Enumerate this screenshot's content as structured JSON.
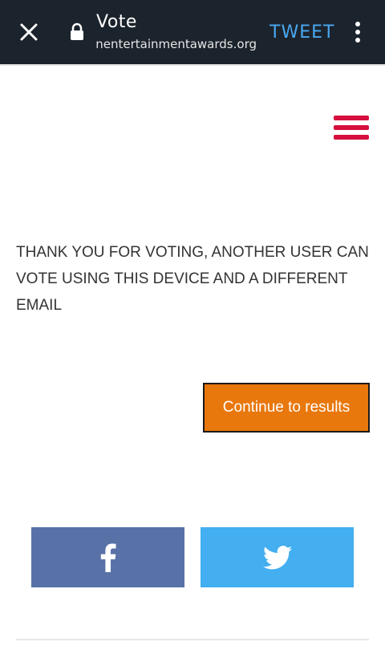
{
  "browser": {
    "title": "Vote",
    "url": "africanentertainmentawards.org",
    "action_label": "TWEET",
    "icons": {
      "close": "close-icon",
      "lock": "lock-icon",
      "more": "more-vertical-icon"
    }
  },
  "page": {
    "menu_icon": "hamburger-menu-icon",
    "menu_color": "#d5103e",
    "message": "THANK YOU FOR VOTING, ANOTHER USER CAN VOTE USING THIS DEVICE AND A DIFFERENT EMAIL",
    "continue_label": "Continue to results",
    "continue_color": "#e8770c",
    "share": {
      "facebook": {
        "icon": "facebook-icon",
        "color": "#5872a8"
      },
      "twitter": {
        "icon": "twitter-icon",
        "color": "#43aef0"
      }
    }
  }
}
